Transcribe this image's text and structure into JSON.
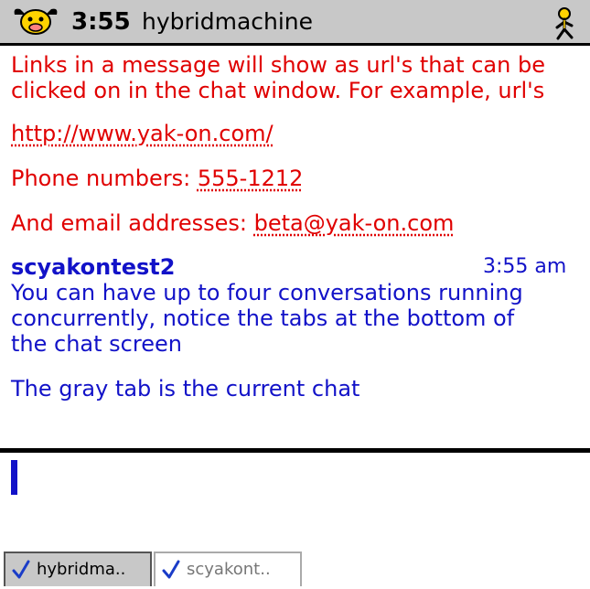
{
  "header": {
    "logo_icon": "yak-icon",
    "time": "3:55",
    "buddy": "hybridmachine",
    "status_icon": "person-status-icon"
  },
  "chat": {
    "intro_line1": "Links in a message will show as url's that can be",
    "intro_line2": "clicked on in the chat window. For example, url's",
    "url": "http://www.yak-on.com/",
    "phone_label": "Phone numbers: ",
    "phone": "555-1212",
    "email_label": "And email addresses: ",
    "email": "beta@yak-on.com",
    "sender": "scyakontest2",
    "msg_time": "3:55 am",
    "msg_line1": "You can have up to four conversations running",
    "msg_line2": "concurrently, notice the tabs at the bottom of",
    "msg_line3": "the chat screen",
    "msg_line4": "The gray tab is the current chat",
    "colors": {
      "incoming": "#e00000",
      "outgoing": "#1212c8"
    }
  },
  "input": {
    "value": ""
  },
  "tabs": [
    {
      "label": "hybridma..",
      "icon": "checkmark-icon",
      "active": true
    },
    {
      "label": "scyakont..",
      "icon": "checkmark-icon",
      "active": false
    }
  ]
}
